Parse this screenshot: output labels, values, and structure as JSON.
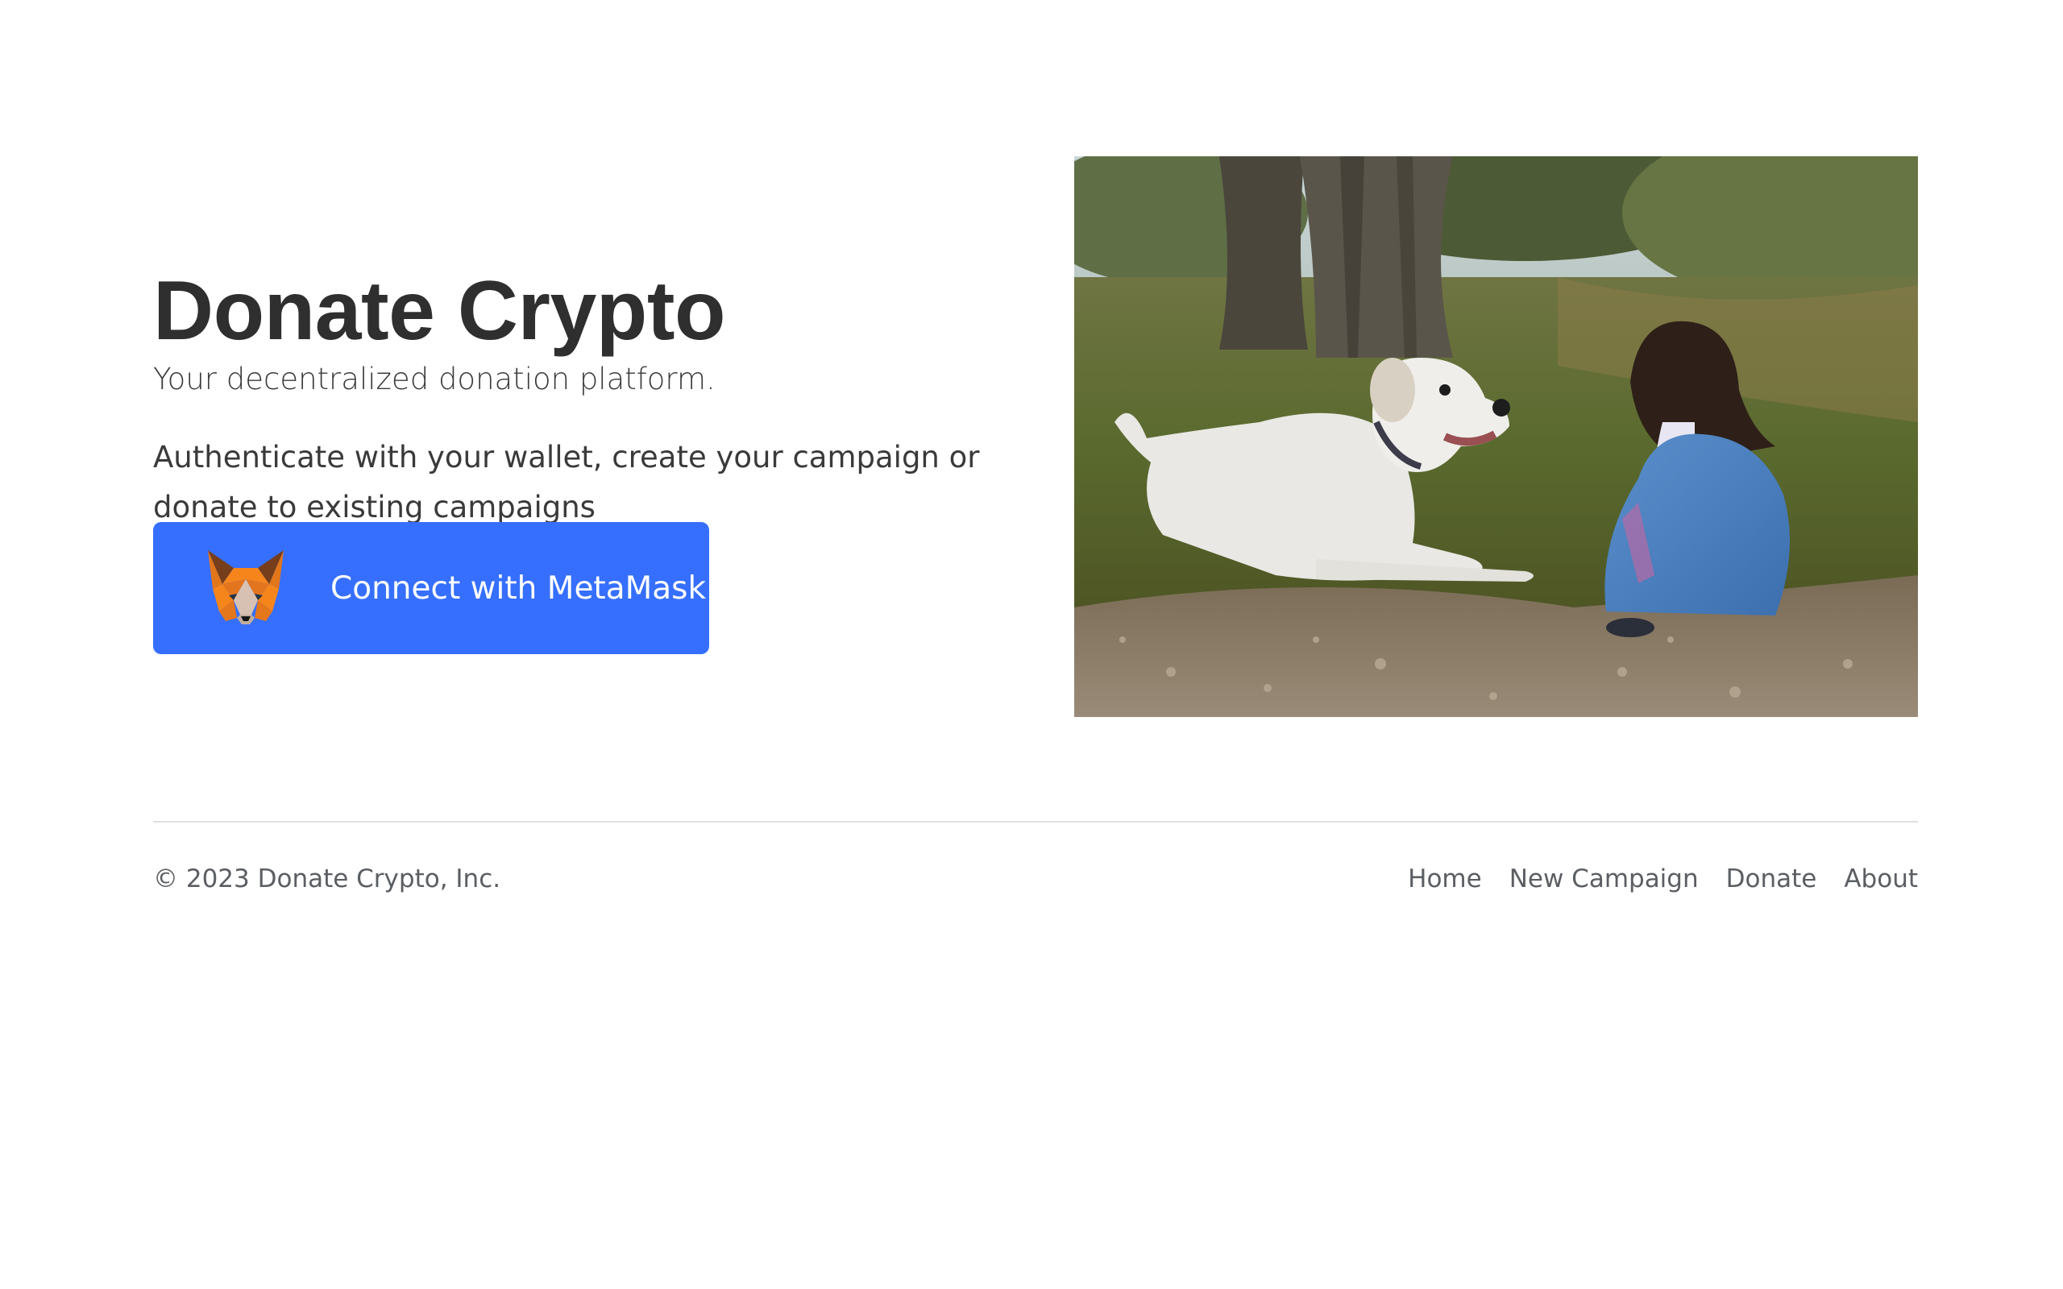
{
  "hero": {
    "title": "Donate Crypto",
    "subtitle": "Your decentralized donation platform.",
    "description": "Authenticate with your wallet, create your campaign or donate to existing campaigns",
    "connect_button": {
      "label": "Connect with MetaMask",
      "icon": "metamask-fox-icon",
      "color": "#366ffd"
    },
    "image": {
      "subject": "white dog lying in grass beside a child in a blue dress under olive trees"
    }
  },
  "footer": {
    "copyright": "© 2023 Donate Crypto, Inc.",
    "links": [
      "Home",
      "New Campaign",
      "Donate",
      "About"
    ]
  }
}
